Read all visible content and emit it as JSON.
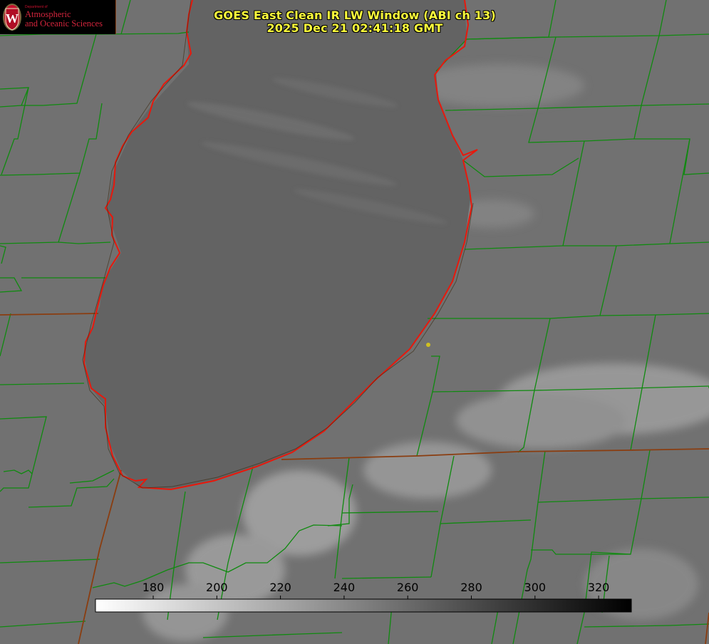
{
  "title": {
    "line1": "GOES East Clean IR LW Window (ABI ch 13)",
    "line2": "2025 Dec 21 02:41:18 GMT"
  },
  "logo": {
    "department": "Department of",
    "name_line1": "Atmospheric",
    "name_line2": "and Oceanic Sciences",
    "seal_letter": "W"
  },
  "colorbar": {
    "ticks": [
      "180",
      "200",
      "220",
      "240",
      "260",
      "280",
      "300",
      "320"
    ],
    "gradient": [
      "#ffffff",
      "#000000"
    ]
  },
  "colors": {
    "title_text": "#ffff3c",
    "coastline": "#e8180c",
    "county_lines": "#0f8a0f",
    "state_lines": "#8a3d10",
    "station_marker": "#d0c020"
  }
}
